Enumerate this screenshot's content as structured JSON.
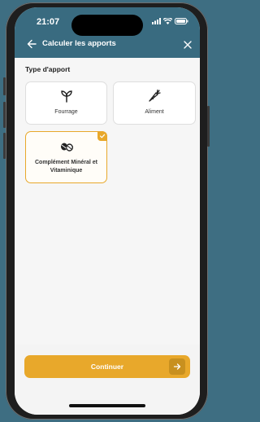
{
  "status": {
    "time": "21:07"
  },
  "header": {
    "title": "Calculer les apports"
  },
  "section": {
    "label": "Type d'apport"
  },
  "options": [
    {
      "label": "Fourrage",
      "icon": "sprout-icon",
      "selected": false
    },
    {
      "label": "Aliment",
      "icon": "carrot-icon",
      "selected": false
    },
    {
      "label": "Complément Minéral et Vitaminique",
      "icon": "pills-icon",
      "selected": true
    }
  ],
  "footer": {
    "continue_label": "Continuer"
  },
  "colors": {
    "header_bg": "#396b80",
    "accent": "#e8a82b",
    "page_bg": "#3e6e82"
  }
}
